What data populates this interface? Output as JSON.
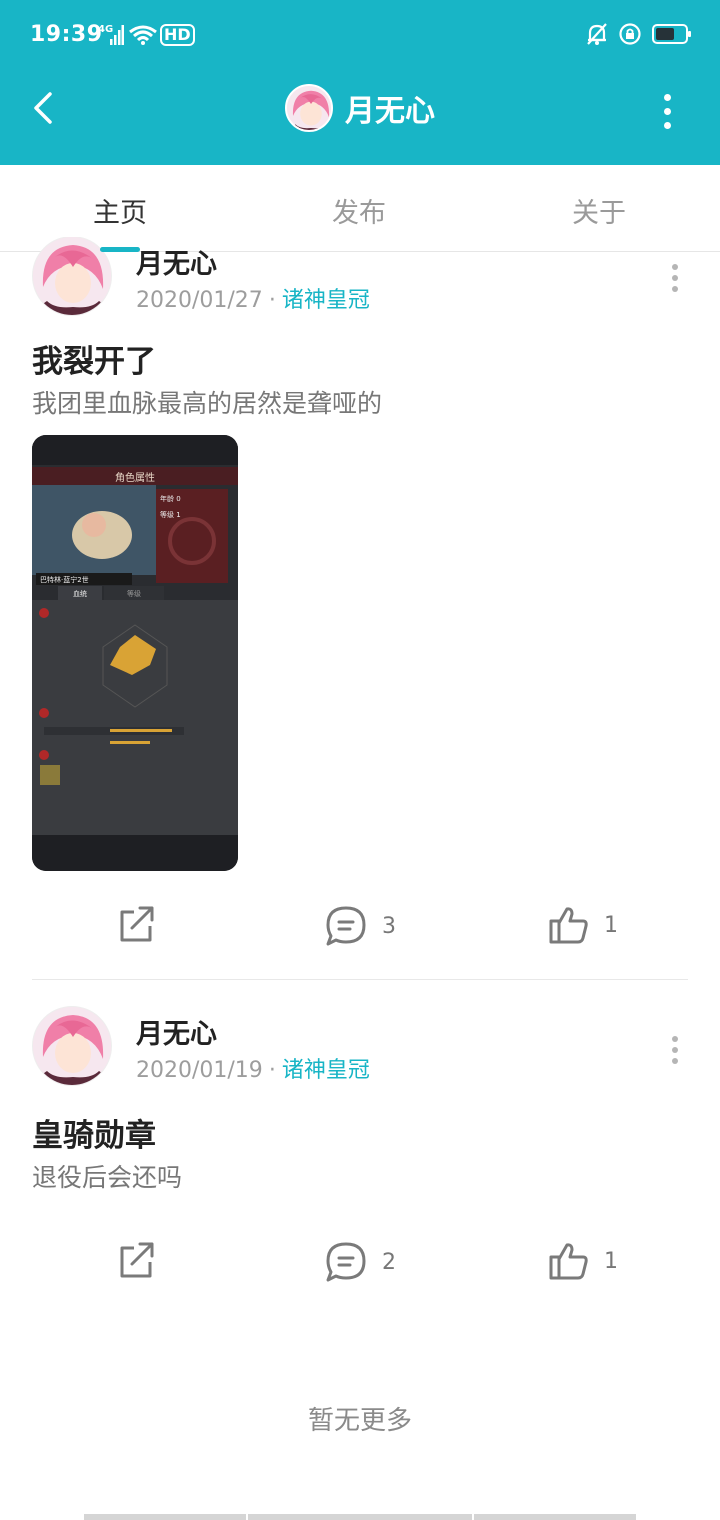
{
  "status_bar": {
    "time": "19:39",
    "network": "4G",
    "hd": "HD"
  },
  "header": {
    "title": "月无心"
  },
  "tabs": [
    {
      "label": "主页"
    },
    {
      "label": "发布"
    },
    {
      "label": "关于"
    }
  ],
  "posts": [
    {
      "author": "月无心",
      "date": "2020/01/27",
      "separator": "·",
      "club": "诸神皇冠",
      "title": "我裂开了",
      "body": "我团里血脉最高的居然是聋哑的",
      "shares": "",
      "comments": "3",
      "likes": "1",
      "screenshot_texts": {
        "title": "角色属性",
        "tab1": "血统",
        "tab2": "等级",
        "stat_age": "年龄  0",
        "stat_level": "等级  1",
        "name": "巴特林·蓝宁2世"
      }
    },
    {
      "author": "月无心",
      "date": "2020/01/19",
      "separator": "·",
      "club": "诸神皇冠",
      "title": "皇骑勋章",
      "body": "退役后会还吗",
      "comments": "2",
      "likes": "1"
    }
  ],
  "footer": {
    "text": "暂无更多"
  },
  "colors": {
    "accent": "#18b5c6",
    "text": "#222222",
    "muted": "#9d9d9d"
  }
}
